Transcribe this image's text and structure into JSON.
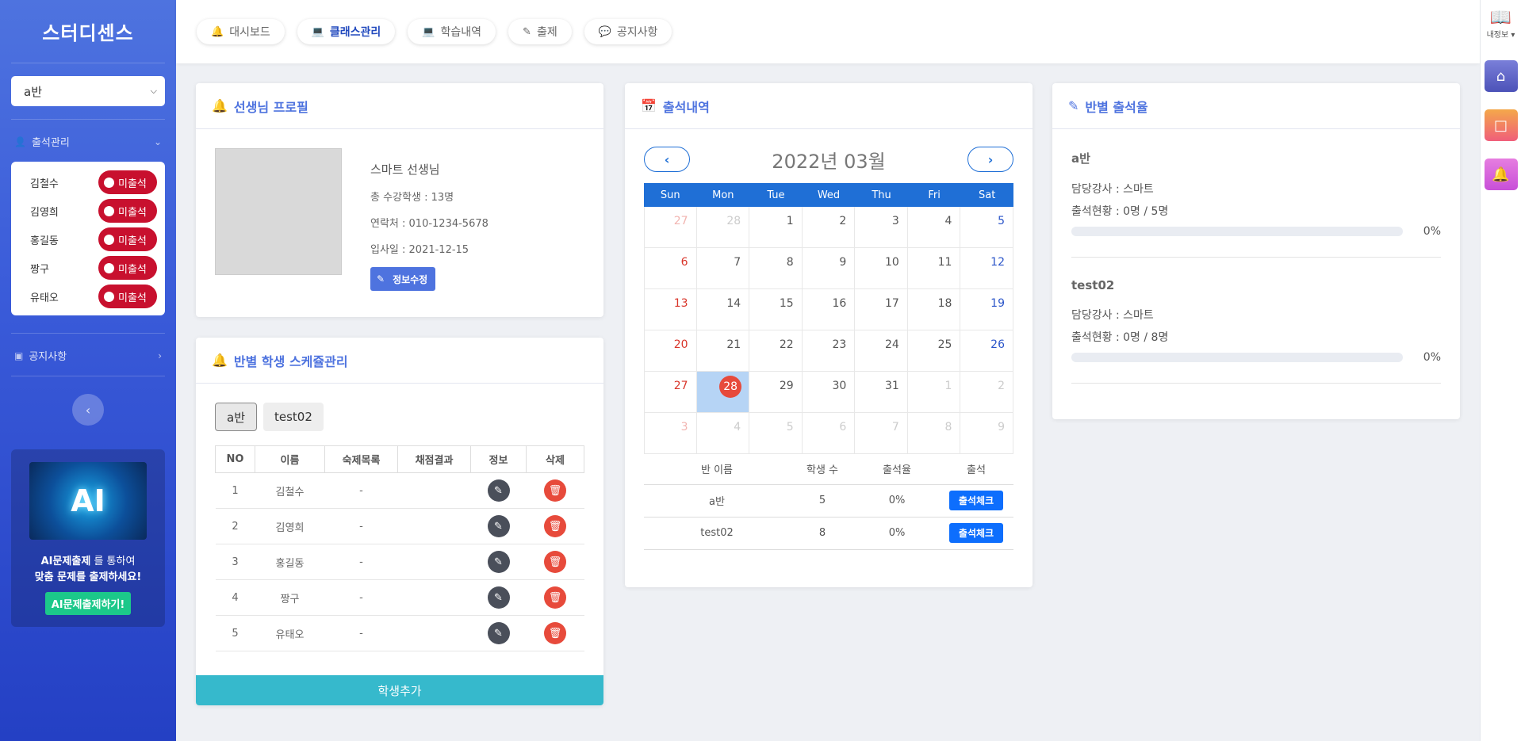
{
  "brand": "스터디센스",
  "sidebar": {
    "class_select": "a반",
    "attendance_heading": "출석관리",
    "attendance": [
      {
        "name": "김철수",
        "status": "미출석"
      },
      {
        "name": "김영희",
        "status": "미출석"
      },
      {
        "name": "홍길동",
        "status": "미출석"
      },
      {
        "name": "짱구",
        "status": "미출석"
      },
      {
        "name": "유태오",
        "status": "미출석"
      }
    ],
    "notice_heading": "공지사항",
    "ai_logo_text": "AI",
    "ai_line1_bold": "AI문제출제",
    "ai_line1_rest": " 를 통하여",
    "ai_line2": "맞춤 문제를 출제하세요!",
    "ai_button": "AI문제출제하기!"
  },
  "topbar": {
    "tabs": [
      {
        "label": "대시보드",
        "icon": "bell-icon",
        "active": false
      },
      {
        "label": "클래스관리",
        "icon": "laptop-icon",
        "active": true
      },
      {
        "label": "학습내역",
        "icon": "laptop-icon",
        "active": false
      },
      {
        "label": "출제",
        "icon": "edit-icon",
        "active": false
      },
      {
        "label": "공지사항",
        "icon": "chat-icon",
        "active": false
      }
    ]
  },
  "rail": {
    "my_info": "내정보"
  },
  "profile": {
    "title": "선생님 프로필",
    "name": "스마트 선생님",
    "total_students": "총 수강학생 : 13명",
    "contact": "연락처 : 010-1234-5678",
    "join_date": "입사일 : 2021-12-15",
    "edit_button": "정보수정"
  },
  "schedule": {
    "title": "반별 학생 스케쥴관리",
    "tabs": [
      "a반",
      "test02"
    ],
    "columns": [
      "NO",
      "이름",
      "숙제목록",
      "채점결과",
      "정보",
      "삭제"
    ],
    "rows": [
      {
        "no": "1",
        "name": "김철수",
        "homework": "-",
        "result": ""
      },
      {
        "no": "2",
        "name": "김영희",
        "homework": "-",
        "result": ""
      },
      {
        "no": "3",
        "name": "홍길동",
        "homework": "-",
        "result": ""
      },
      {
        "no": "4",
        "name": "짱구",
        "homework": "-",
        "result": ""
      },
      {
        "no": "5",
        "name": "유태오",
        "homework": "-",
        "result": ""
      }
    ],
    "add_button": "학생추가"
  },
  "calendar": {
    "title": "출석내역",
    "month_label": "2022년 03월",
    "weekdays": [
      "Sun",
      "Mon",
      "Tue",
      "Wed",
      "Thu",
      "Fri",
      "Sat"
    ],
    "days": [
      {
        "d": "27",
        "other": true
      },
      {
        "d": "28",
        "other": true
      },
      {
        "d": "1"
      },
      {
        "d": "2"
      },
      {
        "d": "3"
      },
      {
        "d": "4"
      },
      {
        "d": "5"
      },
      {
        "d": "6"
      },
      {
        "d": "7"
      },
      {
        "d": "8"
      },
      {
        "d": "9"
      },
      {
        "d": "10"
      },
      {
        "d": "11"
      },
      {
        "d": "12"
      },
      {
        "d": "13"
      },
      {
        "d": "14"
      },
      {
        "d": "15"
      },
      {
        "d": "16"
      },
      {
        "d": "17"
      },
      {
        "d": "18"
      },
      {
        "d": "19"
      },
      {
        "d": "20"
      },
      {
        "d": "21"
      },
      {
        "d": "22"
      },
      {
        "d": "23"
      },
      {
        "d": "24"
      },
      {
        "d": "25"
      },
      {
        "d": "26"
      },
      {
        "d": "27"
      },
      {
        "d": "28",
        "today": true
      },
      {
        "d": "29"
      },
      {
        "d": "30"
      },
      {
        "d": "31"
      },
      {
        "d": "1",
        "other": true
      },
      {
        "d": "2",
        "other": true
      },
      {
        "d": "3",
        "other": true
      },
      {
        "d": "4",
        "other": true
      },
      {
        "d": "5",
        "other": true
      },
      {
        "d": "6",
        "other": true
      },
      {
        "d": "7",
        "other": true
      },
      {
        "d": "8",
        "other": true
      },
      {
        "d": "9",
        "other": true
      }
    ],
    "table_columns": [
      "반 이름",
      "학생 수",
      "출석율",
      "출석"
    ],
    "table_rows": [
      {
        "class": "a반",
        "count": "5",
        "rate": "0%",
        "button": "출석체크"
      },
      {
        "class": "test02",
        "count": "8",
        "rate": "0%",
        "button": "출석체크"
      }
    ]
  },
  "rates": {
    "title": "반별 출석율",
    "classes": [
      {
        "name": "a반",
        "teacher": "담당강사 : 스마트",
        "status": "출석현황 : 0명 / 5명",
        "percent": 0,
        "percent_label": "0%"
      },
      {
        "name": "test02",
        "teacher": "담당강사 : 스마트",
        "status": "출석현황 : 0명 / 8명",
        "percent": 0,
        "percent_label": "0%"
      }
    ]
  },
  "colors": {
    "primary": "#4e73df",
    "calendar_blue": "#1f6fd6",
    "absent_red": "#c8102e",
    "add_teal": "#36b9cc",
    "ai_green": "#1cc88a"
  }
}
